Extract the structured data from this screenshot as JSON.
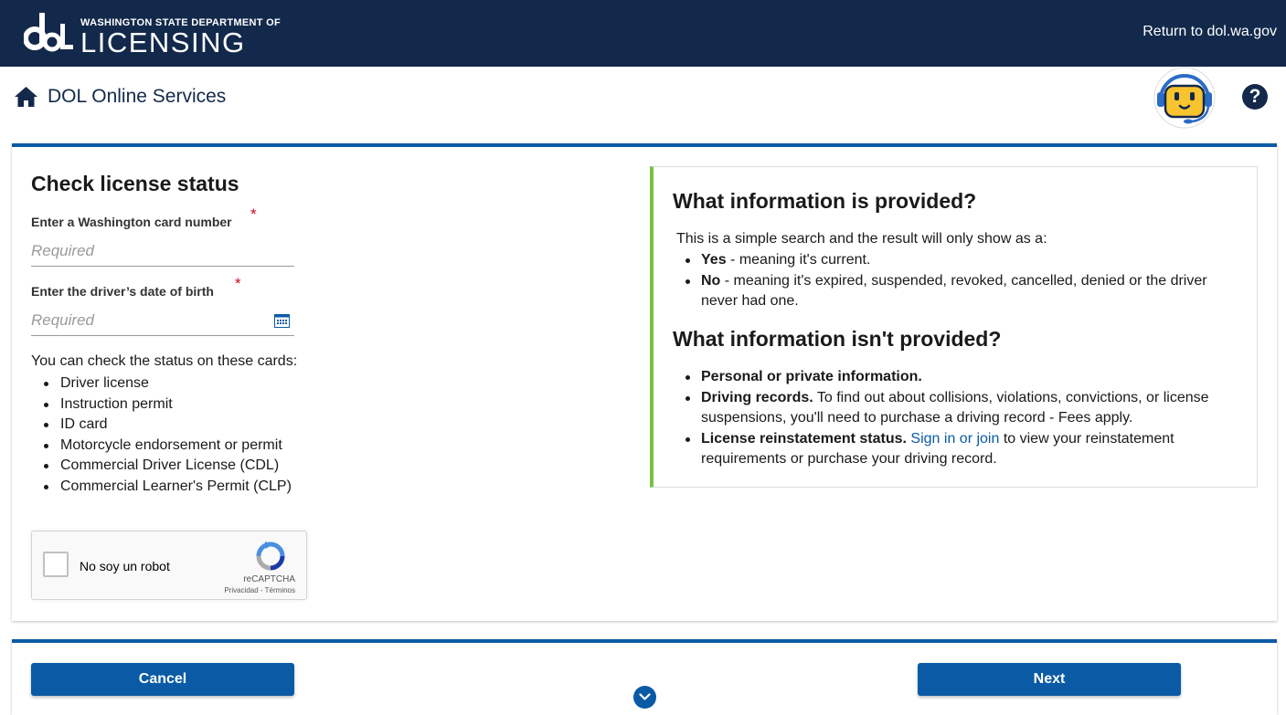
{
  "header": {
    "logo_small": "WASHINGTON STATE DEPARTMENT OF",
    "logo_big": "LICENSING",
    "return_link": "Return to dol.wa.gov",
    "colors": {
      "navy": "#13294b",
      "blue": "#0b5aa6",
      "green": "#7ac143",
      "required": "#d0021b"
    }
  },
  "subheader": {
    "title": "DOL Online Services",
    "help_label": "?",
    "icons": [
      "home-icon",
      "chat-bot-icon",
      "help-icon"
    ]
  },
  "form": {
    "title": "Check license status",
    "card_number": {
      "label": "Enter a Washington card number",
      "placeholder": "Required",
      "required_mark": "*"
    },
    "dob": {
      "label": "Enter the driver’s date of birth",
      "placeholder": "Required",
      "required_mark": "*"
    },
    "cards_intro": "You can check the status on these cards:",
    "cards": [
      "Driver license",
      "Instruction permit",
      "ID card",
      "Motorcycle endorsement or permit",
      "Commercial Driver License (CDL)",
      "Commercial Learner's Permit (CLP)"
    ],
    "recaptcha": {
      "label": "No soy un robot",
      "brand": "reCAPTCHA",
      "links": "Privacidad - Términos"
    }
  },
  "info": {
    "provided_heading": "What information is provided?",
    "provided_intro": "This is a simple search and the result will only show as a:",
    "provided_items": [
      {
        "bold": "Yes",
        "text": " - meaning it's current."
      },
      {
        "bold": "No",
        "text": " - meaning it's expired, suspended, revoked, cancelled, denied or the driver never had one."
      }
    ],
    "not_provided_heading": "What information isn't provided?",
    "not_provided_items": [
      {
        "bold": "Personal or private information.",
        "text": ""
      },
      {
        "bold": "Driving records.",
        "text": " To find out about collisions, violations, convictions, or license suspensions, you'll need to purchase a driving record - Fees apply."
      },
      {
        "bold": "License reinstatement status.",
        "link": "Sign in or join",
        "text": " to view your reinstatement requirements or purchase your driving record."
      }
    ]
  },
  "footer": {
    "cancel_label": "Cancel",
    "next_label": "Next"
  }
}
